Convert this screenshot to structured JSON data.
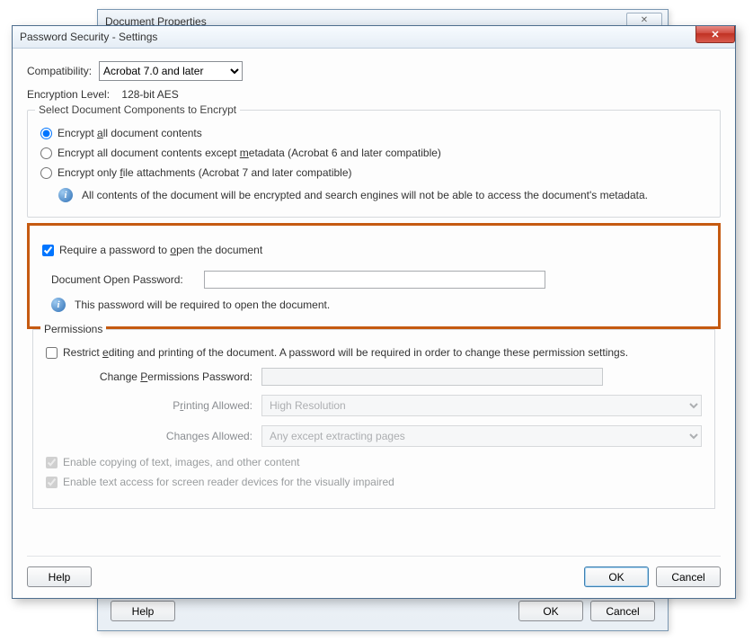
{
  "back_window": {
    "title": "Document Properties",
    "close_glyph": "✕",
    "buttons": {
      "help": "Help",
      "ok": "OK",
      "cancel": "Cancel"
    }
  },
  "dialog": {
    "title": "Password Security - Settings",
    "close_glyph": "✕",
    "compatibility": {
      "label": "Compatibility:",
      "selected": "Acrobat 7.0 and later"
    },
    "encryption": {
      "label": "Encryption  Level:",
      "value": "128-bit AES"
    },
    "encrypt_group": {
      "legend": "Select Document Components to Encrypt",
      "opt1_pre": "Encrypt ",
      "opt1_key": "a",
      "opt1_post": "ll document contents",
      "opt2_pre": "Encrypt all document contents except ",
      "opt2_key": "m",
      "opt2_post": "etadata (Acrobat 6 and later compatible)",
      "opt3_pre": "Encrypt only ",
      "opt3_key": "f",
      "opt3_post": "ile attachments (Acrobat 7 and later compatible)",
      "info": "All contents of the document will be encrypted and search engines will not be able to access the document's metadata."
    },
    "require_group": {
      "check_pre": "Require a password to ",
      "check_key": "o",
      "check_post": "pen the document",
      "pw_label": "Document Open Password:",
      "pw_value": "",
      "info": "This password will be required to open the document."
    },
    "permissions": {
      "legend": "Permissions",
      "restrict_pre": "Restrict ",
      "restrict_key": "e",
      "restrict_post": "diting and printing of the document. A password will be required in order to change these permission settings.",
      "change_pw_pre": "Change ",
      "change_pw_key": "P",
      "change_pw_post": "ermissions Password:",
      "change_pw_value": "",
      "printing_label_pre": "P",
      "printing_label_key": "r",
      "printing_label_post": "inting Allowed:",
      "printing_value": "High Resolution",
      "changes_label_pre": "Chan",
      "changes_label_key": "g",
      "changes_label_post": "es Allowed:",
      "changes_value": "Any except extracting pages",
      "enable_copy": "Enable copying of text, images, and other content",
      "enable_access": "Enable text access for screen reader devices for the visually impaired"
    },
    "buttons": {
      "help": "Help",
      "ok": "OK",
      "cancel": "Cancel"
    }
  }
}
